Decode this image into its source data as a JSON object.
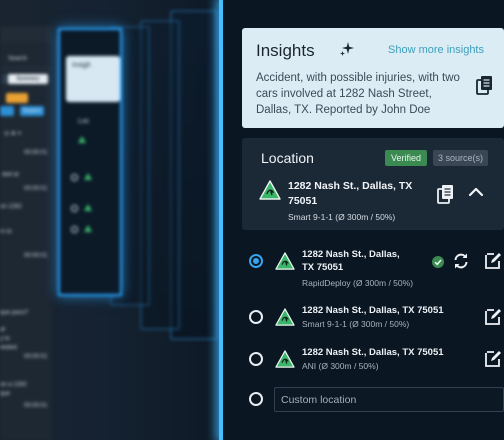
{
  "background": {
    "search_label": "Search",
    "summary_tab": "Summary",
    "suspect_badge": "Suspect",
    "timestamps": [
      "00:00:01",
      "00:00:01",
      "00:00:01",
      "00:00:01",
      "00:00:01"
    ],
    "snippets": [
      "ded at",
      "on 1282",
      "rs to",
      "que paso?",
      "at",
      "y to",
      "eeded",
      "on a 1282",
      "que"
    ],
    "ghost_card_title": "Insigh",
    "ghost_location": "Loc"
  },
  "insights": {
    "title": "Insights",
    "show_more": "Show more insights",
    "text": "Accident, with possible injuries, with two cars involved at 1282 Nash Street, Dallas, TX. Reported by John Doe"
  },
  "location": {
    "title": "Location",
    "verified": "Verified",
    "sources": "3 source(s)",
    "primary": {
      "address": "1282 Nash St., Dallas, TX 75051",
      "detail": "Smart 9-1-1 (Ø 300m / 50%)"
    },
    "options": [
      {
        "address": "1282 Nash St., Dallas, TX 75051",
        "detail": "RapidDeploy (Ø 300m / 50%)",
        "selected": true
      },
      {
        "address": "1282 Nash St., Dallas, TX 75051",
        "detail": "Smart 9-1-1 (Ø 300m / 50%)",
        "selected": false
      },
      {
        "address": "1282 Nash St., Dallas, TX 75051",
        "detail": "ANI (Ø 300m / 50%)",
        "selected": false
      }
    ],
    "custom_placeholder": "Custom location"
  },
  "colors": {
    "accent_blue": "#36a4ee",
    "verified_green": "#3a8a52",
    "location_green": "#3bb56a"
  },
  "icons": [
    "sparkle-icon",
    "copy-icon",
    "location-pin-icon",
    "chevron-up-icon",
    "check-circle-icon",
    "refresh-icon",
    "edit-icon"
  ]
}
